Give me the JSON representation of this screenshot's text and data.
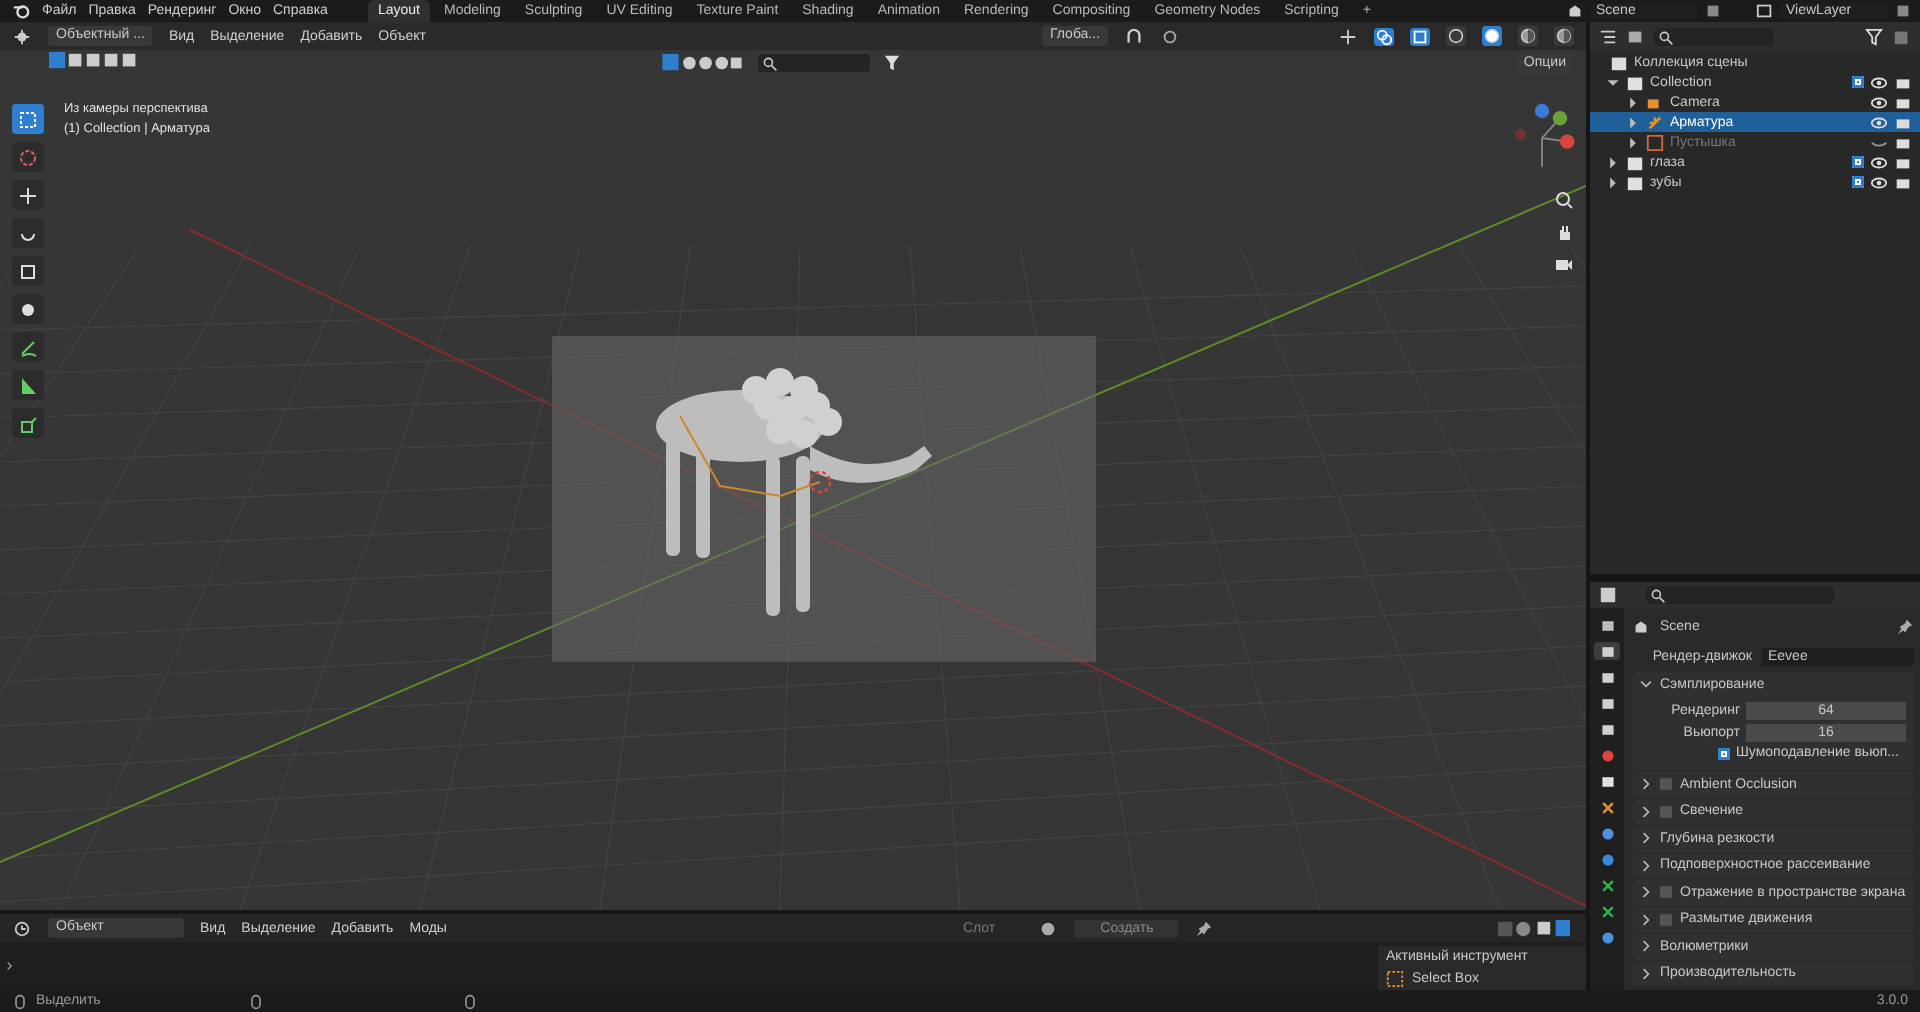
{
  "top_bar": {
    "menus": [
      "Файл",
      "Правка",
      "Рендеринг",
      "Окно",
      "Справка"
    ],
    "workspace_tabs": [
      {
        "label": "Layout",
        "selected": true
      },
      {
        "label": "Modeling",
        "selected": false
      },
      {
        "label": "Sculpting",
        "selected": false
      },
      {
        "label": "UV Editing",
        "selected": false
      },
      {
        "label": "Texture Paint",
        "selected": false
      },
      {
        "label": "Shading",
        "selected": false
      },
      {
        "label": "Animation",
        "selected": false
      },
      {
        "label": "Rendering",
        "selected": false
      },
      {
        "label": "Compositing",
        "selected": false
      },
      {
        "label": "Geometry Nodes",
        "selected": false
      },
      {
        "label": "Scripting",
        "selected": false
      }
    ],
    "add_tab": "+",
    "scene": "Scene",
    "view_layer": "ViewLayer"
  },
  "viewport": {
    "editor_mode": "Объектный ...",
    "menus": [
      "Вид",
      "Выделение",
      "Добавить",
      "Объект"
    ],
    "orientation": "Глоба...",
    "options": "Опции",
    "info_lines": [
      "Из камеры перспектива",
      "(1) Collection | Арматура"
    ],
    "tools": [
      {
        "kind": "select_box",
        "selected": true
      },
      {
        "kind": "cursor",
        "selected": false
      },
      {
        "kind": "move",
        "selected": false
      },
      {
        "kind": "rotate",
        "selected": false
      },
      {
        "kind": "scale",
        "selected": false
      },
      {
        "kind": "transform",
        "selected": false
      },
      {
        "kind": "annotate",
        "selected": false
      },
      {
        "kind": "measure",
        "selected": false
      },
      {
        "kind": "add_cube",
        "selected": false
      }
    ],
    "shading": [
      {
        "kind": "wireframe",
        "selected": false
      },
      {
        "kind": "solid",
        "selected": true
      },
      {
        "kind": "material",
        "selected": false
      },
      {
        "kind": "rendered",
        "selected": false
      }
    ]
  },
  "outliner": {
    "root": "Коллекция сцены",
    "items": [
      {
        "name": "Collection",
        "kind": "collection",
        "expanded": true,
        "checked": true,
        "children": [
          {
            "name": "Camera",
            "kind": "camera",
            "expanded": false,
            "selected": false,
            "visible": true
          },
          {
            "name": "Арматура",
            "kind": "armature",
            "expanded": false,
            "selected": true,
            "visible": true
          },
          {
            "name": "Пустышка",
            "kind": "empty",
            "expanded": false,
            "selected": false,
            "visible": false
          }
        ]
      },
      {
        "name": "глаза",
        "kind": "collection",
        "expanded": false,
        "checked": true
      },
      {
        "name": "зубы",
        "kind": "collection",
        "expanded": false,
        "checked": true
      }
    ]
  },
  "properties": {
    "tabs": [
      {
        "kind": "tool",
        "selected": false
      },
      {
        "kind": "render",
        "selected": true
      },
      {
        "kind": "output",
        "selected": false
      },
      {
        "kind": "view_layer",
        "selected": false
      },
      {
        "kind": "scene",
        "selected": false
      },
      {
        "kind": "world",
        "selected": false
      },
      {
        "kind": "collection",
        "selected": false
      },
      {
        "kind": "object",
        "selected": false
      },
      {
        "kind": "modifiers",
        "selected": false
      },
      {
        "kind": "physics",
        "selected": false
      },
      {
        "kind": "data",
        "selected": false
      },
      {
        "kind": "bone",
        "selected": false
      },
      {
        "kind": "constraints",
        "selected": false
      }
    ],
    "context": "Scene",
    "engine_label": "Рендер-движок",
    "engine": "Eevee",
    "panels": [
      {
        "title": "Сэмплирование",
        "kind": "plain",
        "expanded": true,
        "fields": [
          {
            "label": "Рендеринг",
            "value": "64"
          },
          {
            "label": "Вьюпорт",
            "value": "16"
          }
        ],
        "option": {
          "label": "Шумоподавление вьюп...",
          "checked": true
        }
      },
      {
        "title": "Ambient Occlusion",
        "kind": "toggle",
        "expanded": false,
        "checked": false
      },
      {
        "title": "Свечение",
        "kind": "toggle",
        "expanded": false,
        "checked": false
      },
      {
        "title": "Глубина резкости",
        "kind": "plain",
        "expanded": false
      },
      {
        "title": "Подповерхностное рассеивание",
        "kind": "plain",
        "expanded": false
      },
      {
        "title": "Отражение в пространстве экрана",
        "kind": "toggle",
        "expanded": false,
        "checked": false
      },
      {
        "title": "Размытие движения",
        "kind": "toggle",
        "expanded": false,
        "checked": false
      },
      {
        "title": "Волюметрики",
        "kind": "plain",
        "expanded": false
      },
      {
        "title": "Производительность",
        "kind": "plain",
        "expanded": false
      }
    ]
  },
  "timeline": {
    "mode": "Объект",
    "menus": [
      "Вид",
      "Выделение",
      "Добавить",
      "Моды"
    ],
    "slot": "Слот",
    "new_button": "Создать",
    "active_tool_title": "Активный инструмент",
    "active_tool": "Select Box"
  },
  "status_bar": {
    "hint": "Выделить",
    "version": "3.0.0"
  }
}
